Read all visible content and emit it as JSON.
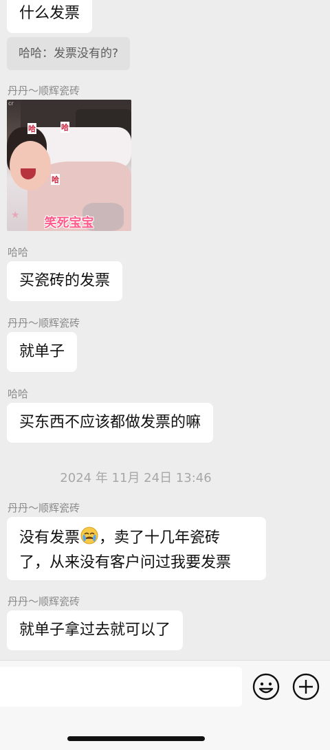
{
  "messages": {
    "m1": {
      "text": "什么发票"
    },
    "quote": {
      "text": "哈哈：发票没有的?"
    },
    "s1": {
      "sender": "丹丹～顺辉瓷砖",
      "sticker_caption": "笑死宝宝",
      "sticker_sound": "哈"
    },
    "s2": {
      "sender": "哈哈",
      "text": "买瓷砖的发票"
    },
    "s3": {
      "sender": "丹丹～顺辉瓷砖",
      "text": "就单子"
    },
    "s4": {
      "sender": "哈哈",
      "text": "买东西不应该都做发票的嘛"
    },
    "timestamp": "2024 年 11月 24日 13:46",
    "s5": {
      "sender": "丹丹～顺辉瓷砖",
      "line1_before": "没有发票",
      "emoji": "crying-face",
      "line1_after": "，卖了十几年瓷砖",
      "line2": "了，从来没有客户问过我要发票"
    },
    "s6": {
      "sender": "丹丹～顺辉瓷砖",
      "text": "就单子拿过去就可以了"
    }
  },
  "inputbar": {
    "icons": [
      "emoji-icon",
      "plus-icon"
    ]
  }
}
